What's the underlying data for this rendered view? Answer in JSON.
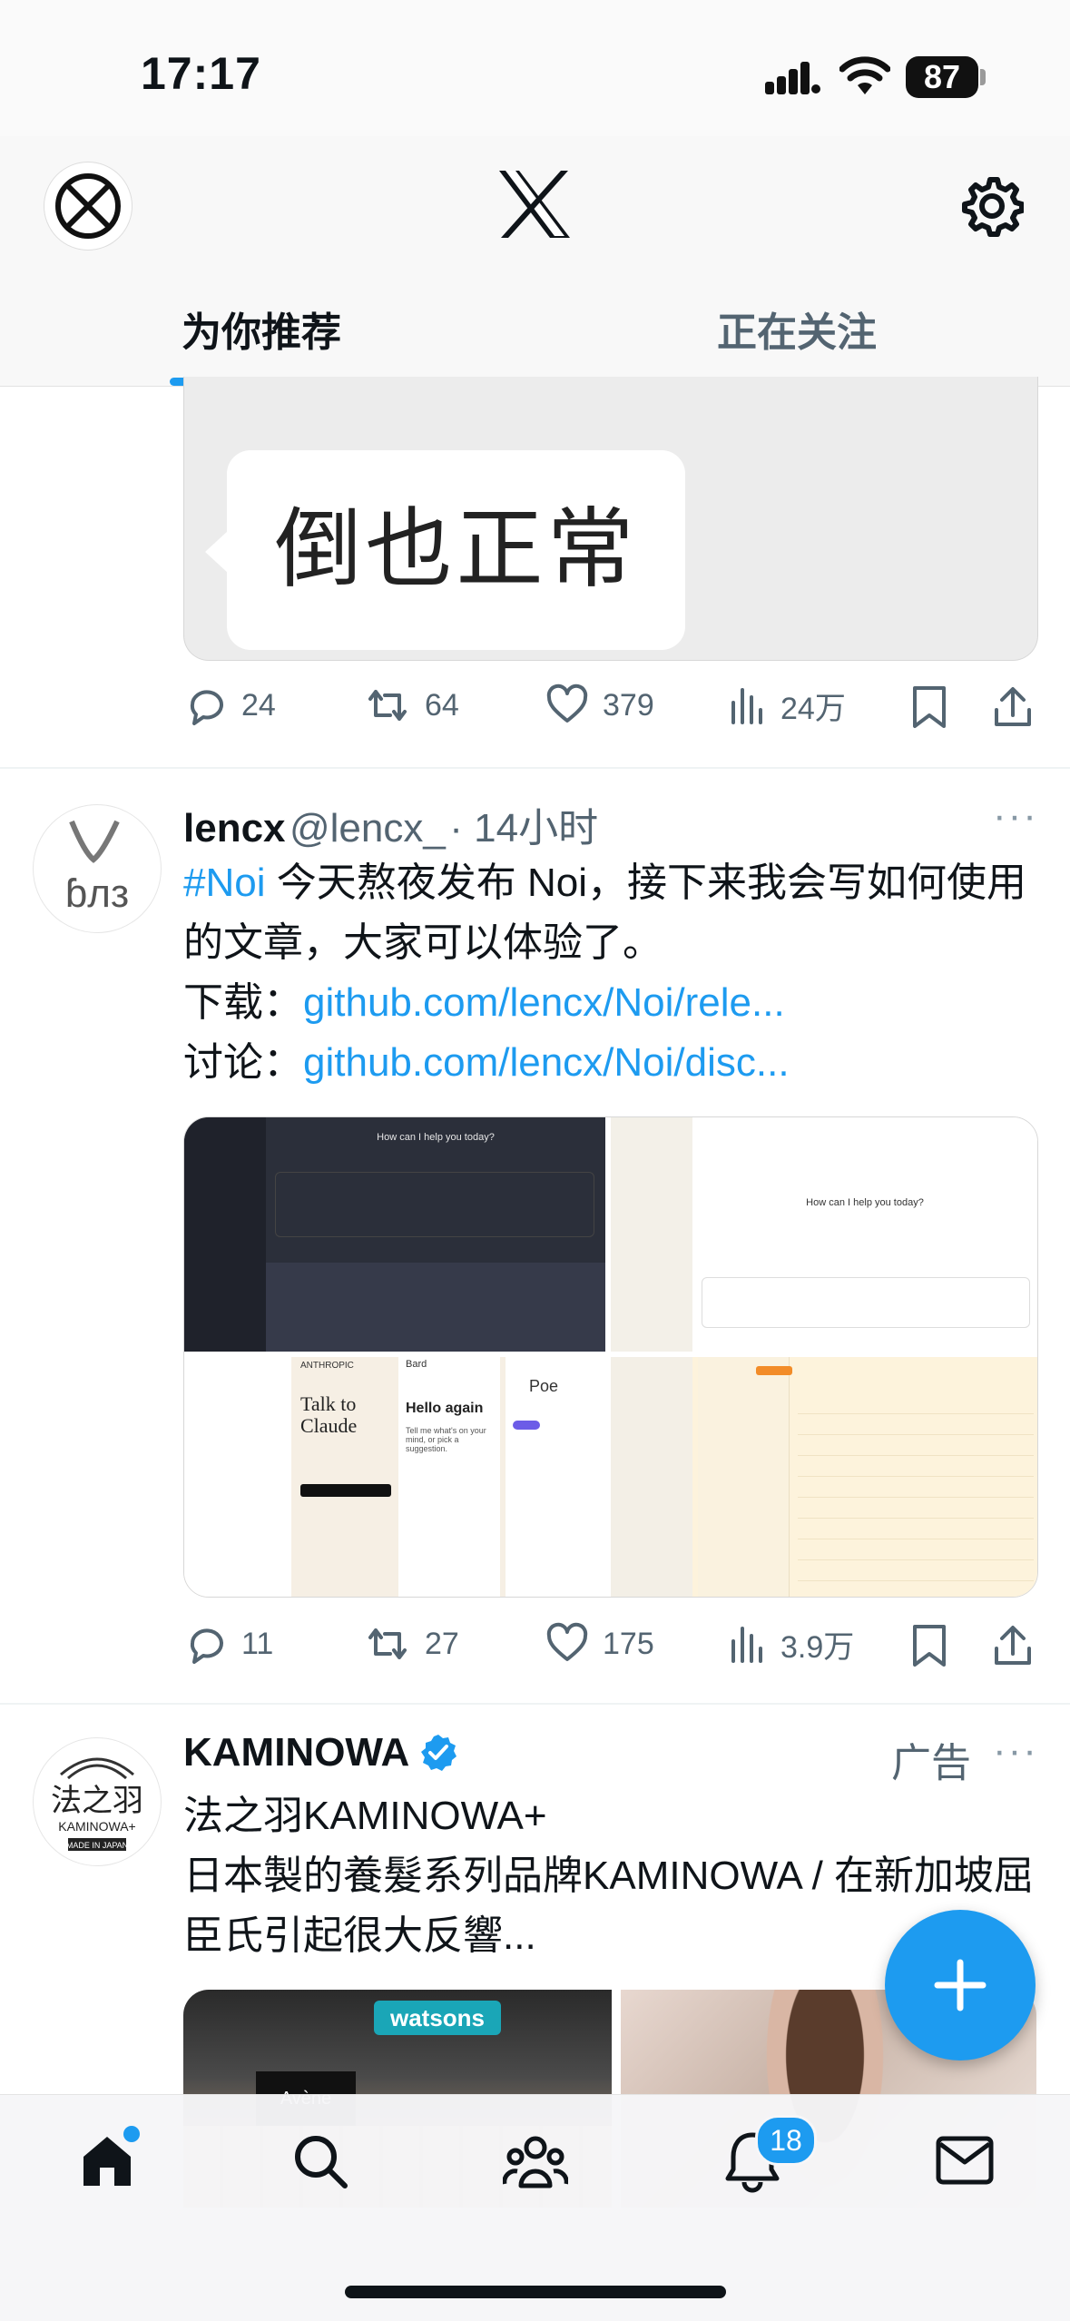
{
  "status": {
    "time": "17:17",
    "battery": "87"
  },
  "header": {
    "logo": "x-logo",
    "tabs": [
      {
        "label": "为你推荐"
      },
      {
        "label": "正在关注"
      }
    ]
  },
  "tweet1": {
    "meme_text": "倒也正常",
    "replies": "24",
    "retweets": "64",
    "likes": "379",
    "views": "24万"
  },
  "tweet2": {
    "name": "lencx",
    "handle": "@lencx_",
    "time": "· 14小时",
    "hashtag": "#Noi",
    "text": " 今天熬夜发布 Noi，接下来我会写如何使用的文章，大家可以体验了。",
    "download_label": "下载：",
    "download_link": "github.com/lencx/Noi/rele...",
    "discuss_label": "讨论：",
    "discuss_link": "github.com/lencx/Noi/disc...",
    "avatar_text": "ɓлз",
    "screens": {
      "chatgpt_prompt": "How can I help you today?",
      "chatgpt_prompt2": "How can I help you today?",
      "claude_brand": "ANTHROPIC",
      "claude_title": "Talk to Claude",
      "bard_title": "Bard",
      "bard_greeting": "Hello again",
      "bard_sub": "Tell me what's on your mind, or pick a suggestion.",
      "poe_title": "Poe"
    },
    "replies": "11",
    "retweets": "27",
    "likes": "175",
    "views": "3.9万"
  },
  "ad": {
    "name": "KAMINOWA",
    "ad_label": "广告",
    "line1": "法之羽KAMINOWA+",
    "line2": "日本製的養髮系列品牌KAMINOWA / 在新加坡屈臣氏引起很大反響...",
    "avatar_main": "法之羽",
    "avatar_sub": "KAMINOWA+",
    "avatar_tag": "MADE IN JAPAN",
    "store_sign": "watsons",
    "store_sub": "Avène"
  },
  "tabbar": {
    "notifications_badge": "18"
  },
  "colors": {
    "accent": "#1d9bf0",
    "text": "#0f1419",
    "muted": "#536471"
  }
}
